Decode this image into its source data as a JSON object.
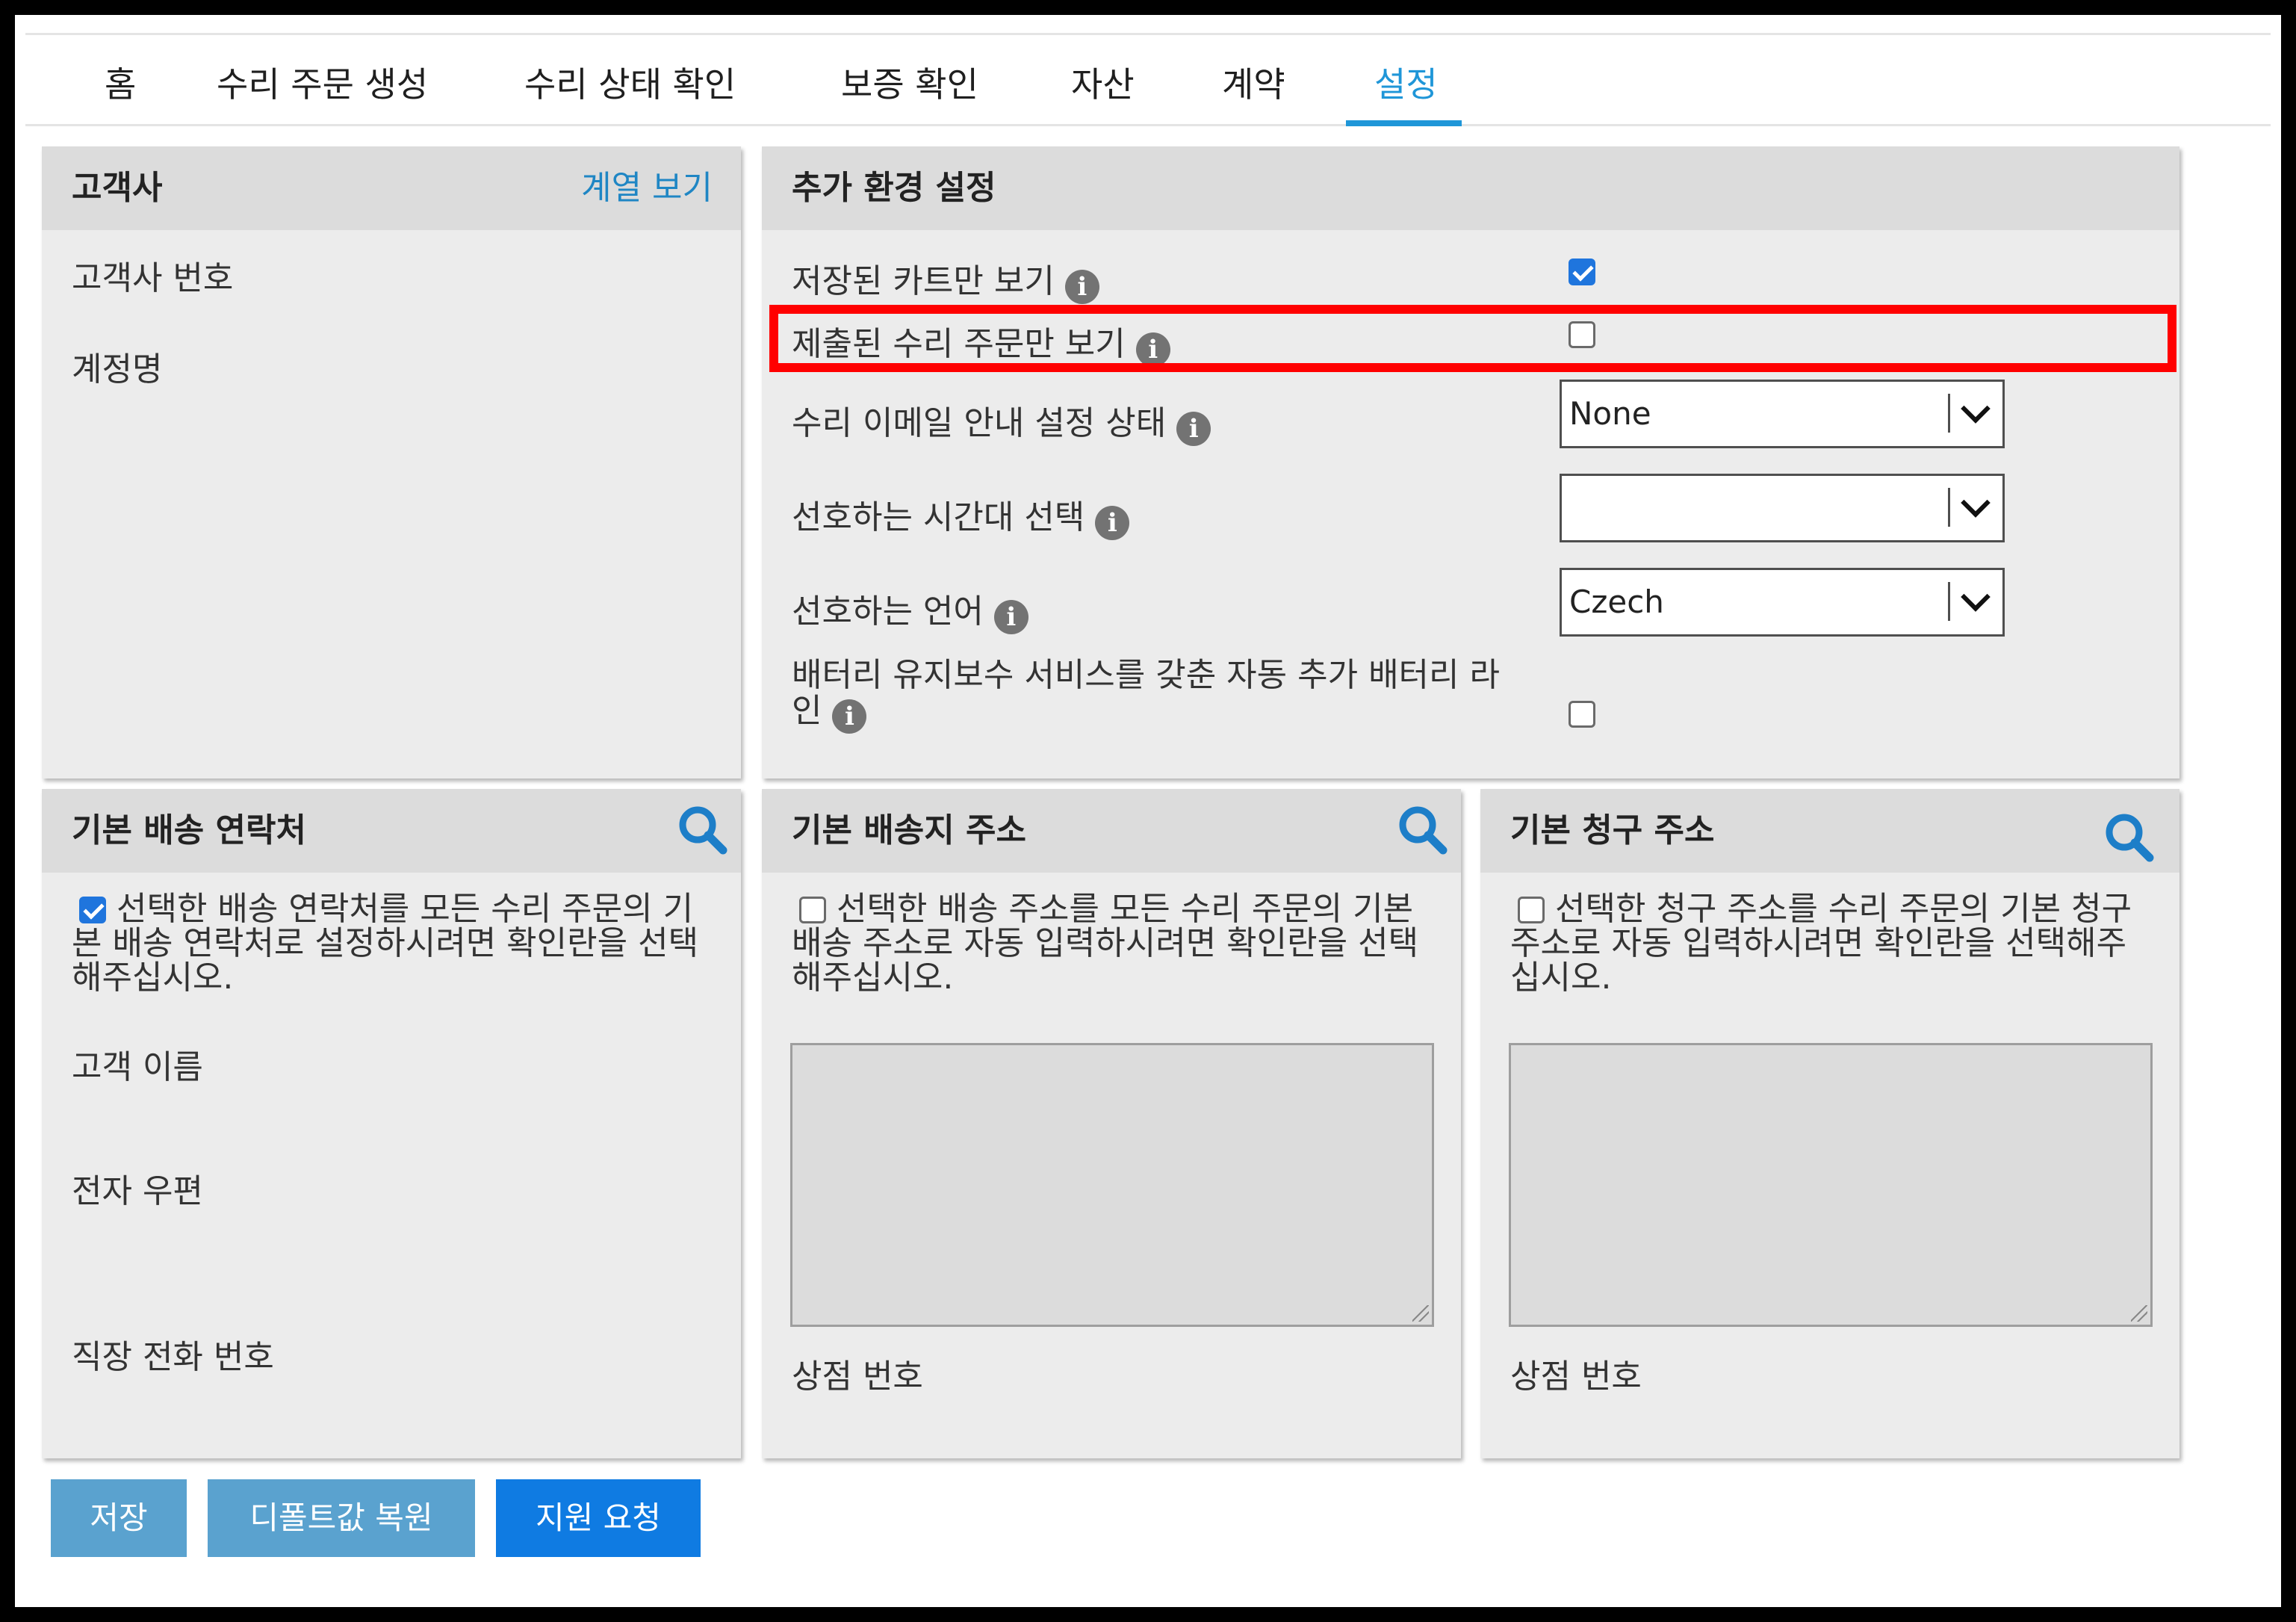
{
  "tabs": [
    "홈",
    "수리 주문 생성",
    "수리 상태 확인",
    "보증 확인",
    "자산",
    "계약",
    "설정"
  ],
  "active_tab": "설정",
  "customer": {
    "title": "고객사",
    "link": "계열 보기",
    "fields": [
      "고객사 번호",
      "계정명"
    ]
  },
  "prefs": {
    "title": "추가 환경 설정",
    "rows": [
      {
        "label": "저장된 카트만 보기",
        "checked": true
      },
      {
        "label": "제출된 수리 주문만 보기",
        "checked": false,
        "highlighted": true
      },
      {
        "label": "수리 이메일 안내 설정 상태",
        "select": "None"
      },
      {
        "label": "선호하는 시간대 선택",
        "select": ""
      },
      {
        "label": "선호하는 언어",
        "select": "Czech"
      },
      {
        "label_line1": "배터리 유지보수 서비스를 갖춘 자동 추가 배터리 라",
        "label_line2": "인",
        "checked": false
      }
    ]
  },
  "contact": {
    "title": "기본 배송 연락처",
    "checkbox_text": "선택한 배송 연락처를 모든 수리 주문의 기본 배송 연락처로 설정하시려면 확인란을 선택해주십시오.",
    "checked": true,
    "fields": [
      "고객 이름",
      "전자 우편",
      "직장 전화 번호"
    ]
  },
  "shipping": {
    "title": "기본 배송지 주소",
    "checkbox_text": "선택한 배송 주소를 모든 수리 주문의 기본 배송 주소로 자동 입력하시려면 확인란을 선택해주십시오.",
    "checked": false,
    "store_label": "상점 번호"
  },
  "billing": {
    "title": "기본 청구 주소",
    "checkbox_text": "선택한 청구 주소를 수리 주문의 기본 청구 주소로 자동 입력하시려면 확인란을 선택해주십시오.",
    "checked": false,
    "store_label": "상점 번호"
  },
  "buttons": {
    "save": "저장",
    "restore": "디폴트값 복원",
    "support": "지원 요청"
  },
  "colors": {
    "accent": "#1f96d8",
    "highlight": "#ff0000",
    "primary_button": "#0f7be2",
    "secondary_button": "#5aa2cf"
  },
  "icons": [
    "info-icon",
    "search-icon",
    "chevron-down-icon",
    "checkbox"
  ]
}
